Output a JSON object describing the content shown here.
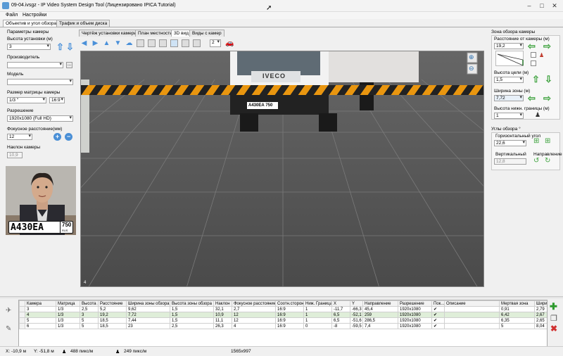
{
  "window": {
    "title": "09-04.ivsgz - IP Video System Design Tool (Лицензировано  IPICA Tutorial)"
  },
  "menu": [
    "Файл",
    "Настройки"
  ],
  "main_tabs": [
    "Объектив и угол обзора",
    "Трафик и объем диска"
  ],
  "left": {
    "section_title": "Параметры камеры",
    "height_label": "Высота установки (м)",
    "height_value": "3",
    "manufacturer_label": "Производитель",
    "manufacturer_value": "",
    "browse_label": "...",
    "model_label": "Модель",
    "model_value": "",
    "matrix_label": "Размер матрицы камеры",
    "matrix_value": "1/3 \"",
    "aspect_value": "16:9",
    "resolution_label": "Разрешение",
    "resolution_value": "1920x1080 (Full HD)",
    "focal_label": "Фокусное расстояние(мм)",
    "focal_value": "12",
    "plus": "+",
    "minus": "−",
    "tilt_label": "Наклон камеры",
    "tilt_value": "10,9",
    "plate_text": "А430ЕА",
    "plate_region": "750",
    "plate_country": "RUS"
  },
  "view_tabs": [
    "Чертёж установки камеры",
    "План местности",
    "3D вид",
    "Виды с камер"
  ],
  "toolbar": {
    "count_value": "2"
  },
  "view3d": {
    "truck_brand": "IVECO",
    "truck_plate": "А430ЕА 750",
    "corner_label": "4"
  },
  "right": {
    "zone_title": "Зона обзора камеры",
    "distance_label": "Расстояние от камеры (м)",
    "distance_value": "19,2",
    "target_height_label": "Высота цели (м)",
    "target_height_value": "1,5",
    "zone_width_label": "Ширина зоны (м)",
    "zone_width_value": "7,72",
    "lower_bound_label": "Высота нижн. границы (м)",
    "lower_bound_value": "1",
    "angles_title": "Углы обзора °",
    "horizontal_label": "Горизонтальный угол",
    "horizontal_value": "22,6",
    "vertical_label": "Вертикальный",
    "vertical_value": "12,8",
    "direction_label": "Направление"
  },
  "table": {
    "headers": [
      "Камера",
      "Матрица",
      "Высота ...",
      "Расстояние",
      "Ширина зоны обзора",
      "Высота зоны обзора",
      "Наклон",
      "Фокусное расстояние",
      "Соотн.сторон",
      "Ниж. Граница",
      "X",
      "Y",
      "Направление",
      "Разрешение",
      "Пок...",
      "Описание",
      "Мертвая зона",
      "Ширина"
    ],
    "rows": [
      [
        "3",
        "1/3",
        "2,5",
        "5,2",
        "9,62",
        "1,5",
        "32,1",
        "2,7",
        "16:9",
        "1",
        "-11,7",
        "-66,3",
        "45,4",
        "1920x1080",
        "✔",
        "",
        "0,91",
        "2,79"
      ],
      [
        "4",
        "1/3",
        "3",
        "19,2",
        "7,72",
        "1,5",
        "10,9",
        "12",
        "16:9",
        "1",
        "6,5",
        "-52,1",
        "259",
        "1920x1080",
        "✔",
        "",
        "6,42",
        "2,67"
      ],
      [
        "5",
        "1/3",
        "5",
        "18,5",
        "7,44",
        "1,5",
        "11,1",
        "12",
        "16:9",
        "1",
        "6,5",
        "-51,6",
        "286,5",
        "1920x1080",
        "✔",
        "",
        "6,35",
        "2,65"
      ],
      [
        "6",
        "1/3",
        "5",
        "18,5",
        "23",
        "2,5",
        "26,3",
        "4",
        "16:9",
        "0",
        "-8",
        "-59,5",
        "7,4",
        "1920x1080",
        "✔",
        "",
        "5",
        "8,04"
      ]
    ]
  },
  "status": {
    "x": "X: -10,9 м",
    "y": "Y: -51,8 м",
    "px1": "488 пикс/м",
    "px2": "249 пикс/м",
    "resolution": "1565x997"
  }
}
